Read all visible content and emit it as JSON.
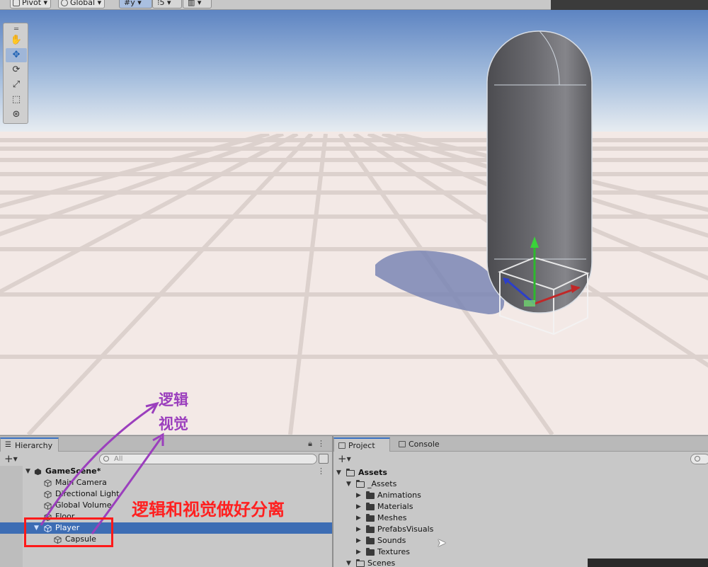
{
  "toolbar": {
    "pivot_label": "Pivot",
    "global_label": "Global"
  },
  "colors": {
    "selection": "#3d6db4",
    "annotation_purple": "#9b3fbd",
    "annotation_red": "#ff2020",
    "sky_top": "#5d84c2",
    "floor": "#f3e9e6"
  },
  "scene_tools": [
    "hand-icon",
    "move-icon",
    "rotate-icon",
    "scale-icon",
    "rect-icon",
    "transform-icon"
  ],
  "annotations": {
    "logic_label": "逻辑",
    "visual_label": "视觉",
    "separation_note": "逻辑和视觉做好分离"
  },
  "hierarchy": {
    "tab_label": "Hierarchy",
    "search_placeholder": "All",
    "scene_name": "GameScene*",
    "items": [
      "Main Camera",
      "Directional Light",
      "Global Volume",
      "Floor",
      "Player",
      "Capsule"
    ]
  },
  "project": {
    "tabs": [
      "Project",
      "Console"
    ],
    "root": "Assets",
    "subroot": "_Assets",
    "folders": [
      "Animations",
      "Materials",
      "Meshes",
      "PrefabsVisuals",
      "Sounds",
      "Textures"
    ],
    "next": "Scenes"
  }
}
